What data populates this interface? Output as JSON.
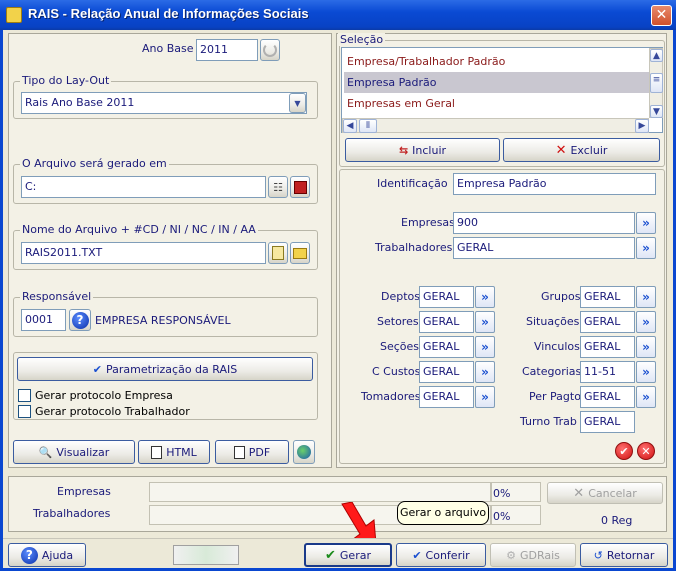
{
  "window": {
    "title": "RAIS - Relação Anual de Informações Sociais",
    "close": "✕"
  },
  "left": {
    "ano_base": {
      "label": "Ano Base",
      "value": "2011"
    },
    "tipo_layout": {
      "label": "Tipo do Lay-Out",
      "value": "Rais Ano Base 2011"
    },
    "arquivo_gerado": {
      "label": "O Arquivo será gerado em",
      "value": "C:"
    },
    "nome_arquivo": {
      "label": "Nome do Arquivo + #CD / NI / NC / IN / AA",
      "value": "RAIS2011.TXT"
    },
    "responsavel": {
      "label": "Responsável",
      "code": "0001",
      "name": "EMPRESA RESPONSÁVEL"
    },
    "parametrizacao_label": "Parametrização da RAIS",
    "checks": [
      {
        "label": "Gerar protocolo Empresa",
        "checked": false
      },
      {
        "label": "Gerar protocolo Trabalhador",
        "checked": false
      }
    ],
    "buttons": {
      "visualizar": "Visualizar",
      "html": "HTML",
      "pdf": "PDF"
    }
  },
  "selecao": {
    "label": "Seleção",
    "items": [
      "Empresa/Trabalhador Padrão",
      "Empresa Padrão",
      "Empresas em Geral"
    ],
    "selected_index": 1,
    "incluir": "Incluir",
    "excluir": "Excluir"
  },
  "detalhes": {
    "identificacao": {
      "label": "Identificação",
      "value": "Empresa Padrão"
    },
    "empresas": {
      "label": "Empresas",
      "value": "900"
    },
    "trabalhadores": {
      "label": "Trabalhadores",
      "value": "GERAL"
    },
    "left_fields": [
      {
        "label": "Deptos",
        "value": "GERAL"
      },
      {
        "label": "Setores",
        "value": "GERAL"
      },
      {
        "label": "Seções",
        "value": "GERAL"
      },
      {
        "label": "C Custos",
        "value": "GERAL"
      },
      {
        "label": "Tomadores",
        "value": "GERAL"
      }
    ],
    "right_fields": [
      {
        "label": "Grupos",
        "value": "GERAL"
      },
      {
        "label": "Situações",
        "value": "GERAL"
      },
      {
        "label": "Vinculos",
        "value": "GERAL"
      },
      {
        "label": "Categorias",
        "value": "11-51"
      },
      {
        "label": "Per Pagto",
        "value": "GERAL"
      },
      {
        "label": "Turno Trab",
        "value": "GERAL"
      }
    ],
    "arrow": "»"
  },
  "progress": {
    "empresas": {
      "label": "Empresas",
      "percent": "0%"
    },
    "trabalhadores": {
      "label": "Trabalhadores",
      "percent": "0%"
    },
    "cancelar": "Cancelar",
    "reg": "0 Reg"
  },
  "tooltip": "Gerar o arquivo",
  "bottom": {
    "ajuda": "Ajuda",
    "gerar": "Gerar",
    "conferir": "Conferir",
    "gdrais": "GDRais",
    "retornar": "Retornar"
  },
  "colors": {
    "title_bar": "#0a4ad4",
    "panel": "#f3f1e6",
    "text": "#1a1a7a",
    "accent_red": "#d01010"
  }
}
